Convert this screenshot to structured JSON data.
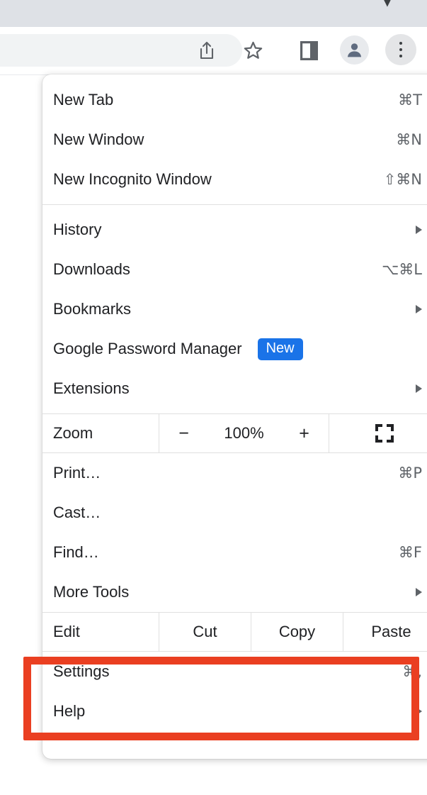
{
  "browser": {
    "toolbar": {
      "share_icon": "share-icon",
      "bookmark_icon": "star-icon",
      "side_panel_icon": "side-panel-icon",
      "profile_icon": "avatar-person-icon",
      "menu_icon": "three-dot-menu-icon"
    },
    "tabstrip": {
      "chevron_icon": "chevron-down-icon"
    }
  },
  "menu": {
    "groups": [
      {
        "items": [
          {
            "label": "New Tab",
            "accel": "⌘T"
          },
          {
            "label": "New Window",
            "accel": "⌘N"
          },
          {
            "label": "New Incognito Window",
            "accel": "⇧⌘N"
          }
        ]
      },
      {
        "items": [
          {
            "label": "History",
            "arrow": true
          },
          {
            "label": "Downloads",
            "accel": "⌥⌘L"
          },
          {
            "label": "Bookmarks",
            "arrow": true
          },
          {
            "label": "Google Password Manager",
            "badge": "New"
          },
          {
            "label": "Extensions",
            "arrow": true
          }
        ]
      },
      {
        "items": [
          {
            "label": "Print…",
            "accel": "⌘P"
          },
          {
            "label": "Cast…"
          },
          {
            "label": "Find…",
            "accel": "⌘F"
          },
          {
            "label": "More Tools",
            "arrow": true
          }
        ]
      },
      {
        "items": [
          {
            "label": "Settings",
            "accel": "⌘,"
          },
          {
            "label": "Help",
            "arrow": true
          }
        ]
      }
    ],
    "zoom_row": {
      "label": "Zoom",
      "minus": "−",
      "value": "100%",
      "plus": "+",
      "fullscreen_icon": "fullscreen-icon"
    },
    "edit_row": {
      "label": "Edit",
      "cut": "Cut",
      "copy": "Copy",
      "paste": "Paste"
    }
  },
  "annotation": {
    "highlight_color": "#ea3f21",
    "target": "Settings"
  }
}
